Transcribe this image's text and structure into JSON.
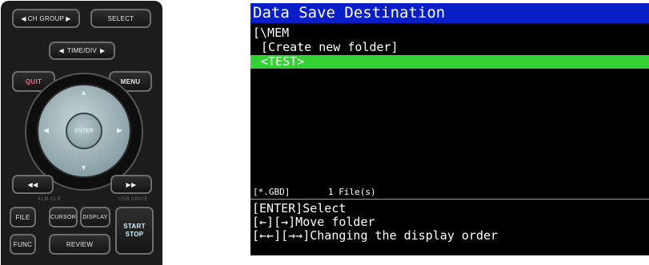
{
  "panel": {
    "ch_group": "CH GROUP",
    "select": "SELECT",
    "time_div": "TIME/DIV",
    "quit": "QUIT",
    "menu": "MENU",
    "enter": "ENTER",
    "alm_clr": "ALM CLR",
    "usb_drive": "USB DRIVE",
    "file": "FILE",
    "cursor": "CURSOR",
    "display": "DISPLAY",
    "start": "START",
    "stop": "STOP",
    "func": "FUNC",
    "review": "REVIEW",
    "accent_red": "#ff6a7a",
    "dpad_color": "#8aa2a7"
  },
  "screen": {
    "title": "Data Save Destination",
    "path": "[\\MEM",
    "items": [
      "[Create new folder]",
      "<TEST>"
    ],
    "selected_index": 1,
    "filter": "[*.GBD]",
    "file_count": "1 File(s)",
    "help": [
      "[ENTER]Select",
      "[←][→]Move folder",
      "[←←][→→]Changing the display order"
    ],
    "colors": {
      "title_bar": "#0a1ec8",
      "selection": "#33d133",
      "background": "#000000"
    }
  }
}
